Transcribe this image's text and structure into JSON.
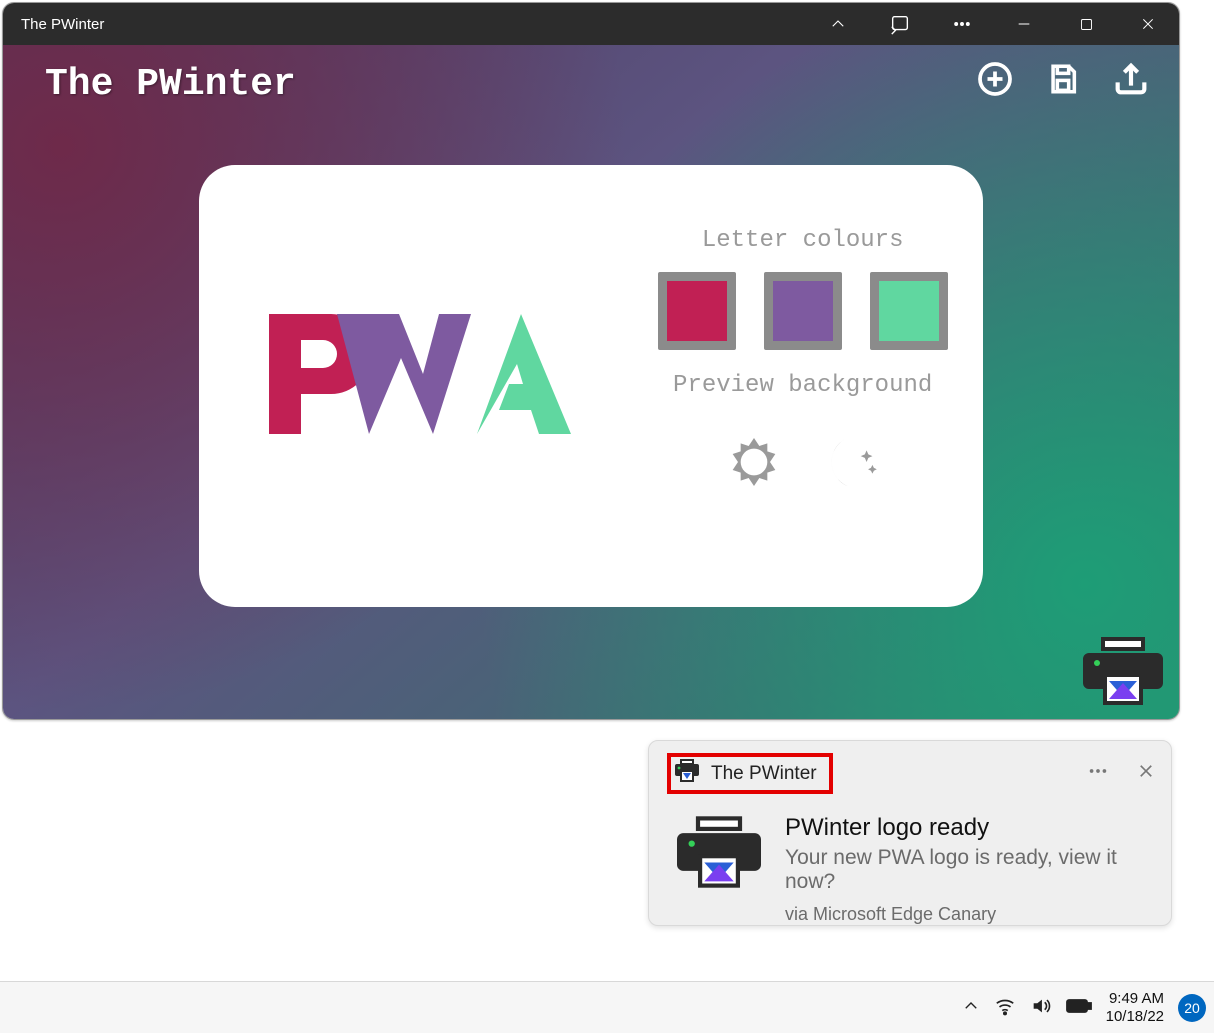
{
  "window": {
    "title": "The PWinter"
  },
  "app": {
    "heading": "The PWinter",
    "card": {
      "letter_colours_label": "Letter colours",
      "preview_bg_label": "Preview background",
      "colors": {
        "p": "#c12054",
        "w": "#7e5aa0",
        "a": "#60d7a0"
      }
    }
  },
  "notification": {
    "app_name": "The PWinter",
    "title": "PWinter logo ready",
    "body": "Your new PWA logo is ready, view it now?",
    "source": "via Microsoft Edge Canary"
  },
  "taskbar": {
    "time": "9:49 AM",
    "date": "10/18/22",
    "badge": "20"
  }
}
